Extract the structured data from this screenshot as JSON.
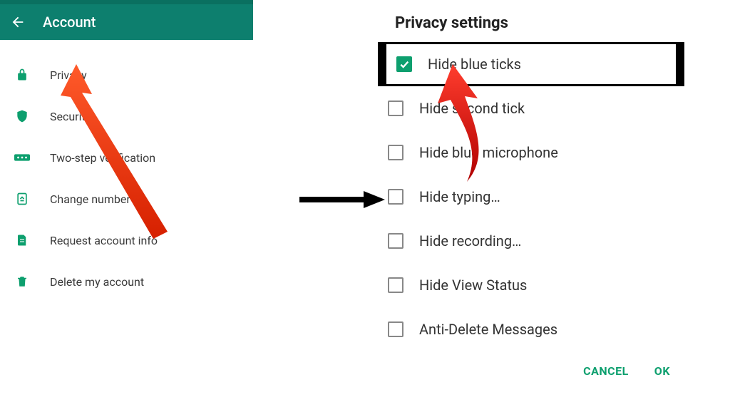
{
  "left": {
    "header_title": "Account",
    "items": [
      {
        "label": "Privacy"
      },
      {
        "label": "Security"
      },
      {
        "label": "Two-step verification"
      },
      {
        "label": "Change number"
      },
      {
        "label": "Request account info"
      },
      {
        "label": "Delete my account"
      }
    ]
  },
  "right": {
    "title": "Privacy settings",
    "options": [
      {
        "label": "Hide blue ticks",
        "checked": true
      },
      {
        "label": "Hide second tick",
        "checked": false
      },
      {
        "label": "Hide blue microphone",
        "checked": false
      },
      {
        "label": "Hide typing…",
        "checked": false
      },
      {
        "label": "Hide recording…",
        "checked": false
      },
      {
        "label": "Hide View Status",
        "checked": false
      },
      {
        "label": "Anti-Delete Messages",
        "checked": false
      }
    ],
    "cancel": "CANCEL",
    "ok": "OK"
  }
}
